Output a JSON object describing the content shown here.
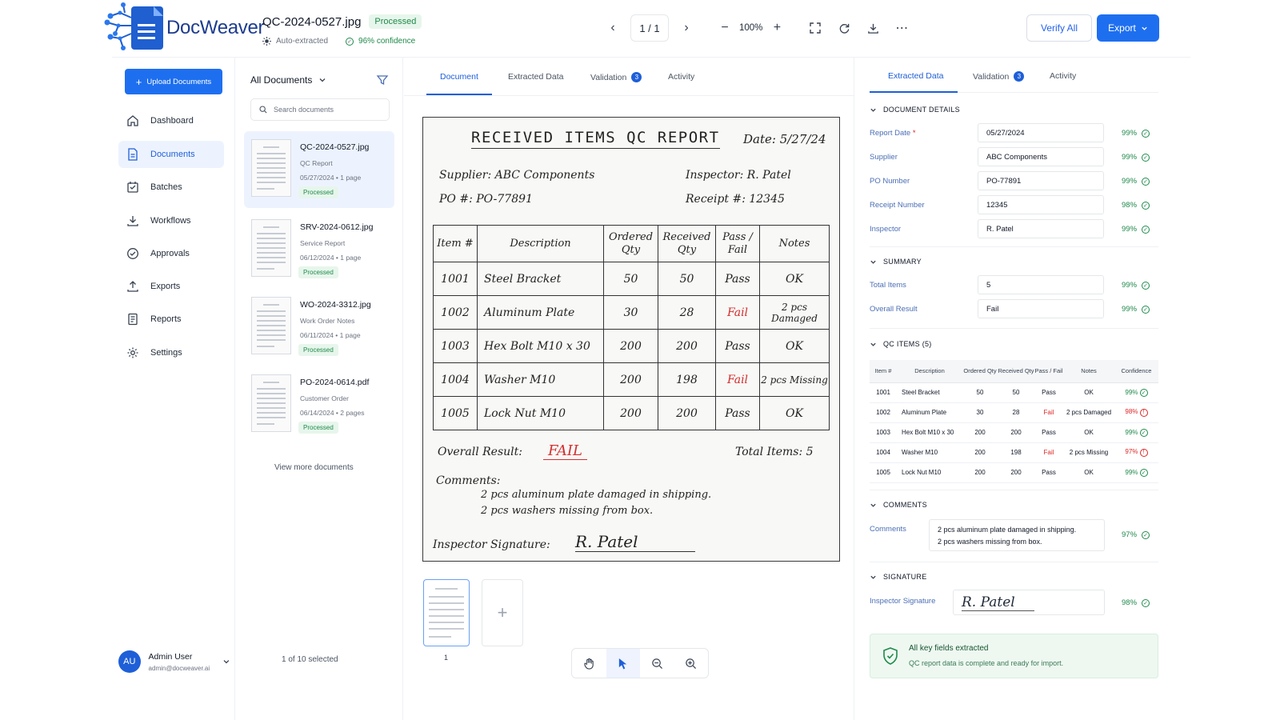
{
  "app": {
    "name": "DocWeaver"
  },
  "document": {
    "filename": "QC-2024-0527.jpg",
    "status": "Processed",
    "extraction": "Auto-extracted",
    "confidence": "96% confidence"
  },
  "viewer_controls": {
    "page": "1 / 1",
    "zoom": "100%"
  },
  "actions": {
    "verify_all": "Verify All",
    "export": "Export"
  },
  "nav": {
    "upload": "Upload Documents",
    "items": [
      {
        "label": "Dashboard",
        "icon": "home-icon"
      },
      {
        "label": "Documents",
        "icon": "document-icon"
      },
      {
        "label": "Batches",
        "icon": "batch-icon"
      },
      {
        "label": "Workflows",
        "icon": "workflow-icon"
      },
      {
        "label": "Approvals",
        "icon": "check-circle-icon"
      },
      {
        "label": "Exports",
        "icon": "export-icon"
      },
      {
        "label": "Reports",
        "icon": "report-icon"
      },
      {
        "label": "Settings",
        "icon": "gear-icon"
      }
    ],
    "active": "Documents"
  },
  "user": {
    "initials": "AU",
    "name": "Admin User",
    "email": "admin@docweaver.ai"
  },
  "doclist": {
    "header": "All Documents",
    "search_placeholder": "Search documents",
    "items": [
      {
        "name": "QC-2024-0527.jpg",
        "type": "QC Report",
        "meta": "05/27/2024 • 1 page",
        "status": "Processed"
      },
      {
        "name": "SRV-2024-0612.jpg",
        "type": "Service Report",
        "meta": "06/12/2024 • 1 page",
        "status": "Processed"
      },
      {
        "name": "WO-2024-3312.jpg",
        "type": "Work Order Notes",
        "meta": "06/11/2024 • 1 page",
        "status": "Processed"
      },
      {
        "name": "PO-2024-0614.pdf",
        "type": "Customer Order",
        "meta": "06/14/2024 • 2 pages",
        "status": "Processed"
      }
    ],
    "view_more": "View more documents",
    "selection": "1 of 10 selected"
  },
  "viewer_tabs": {
    "document": "Document",
    "extracted": "Extracted Data",
    "validation": "Validation",
    "validation_count": "3",
    "activity": "Activity"
  },
  "paper": {
    "title": "RECEIVED ITEMS QC REPORT",
    "date": "Date: 5/27/24",
    "supplier": "Supplier: ABC Components",
    "inspector": "Inspector: R. Patel",
    "po": "PO #: PO-77891",
    "receipt": "Receipt #: 12345",
    "headers": [
      "Item #",
      "Description",
      "Ordered Qty",
      "Received Qty",
      "Pass / Fail",
      "Notes"
    ],
    "rows": [
      [
        "1001",
        "Steel Bracket",
        "50",
        "50",
        "Pass",
        "OK"
      ],
      [
        "1002",
        "Aluminum Plate",
        "30",
        "28",
        "Fail",
        "2 pcs Damaged"
      ],
      [
        "1003",
        "Hex Bolt M10 x 30",
        "200",
        "200",
        "Pass",
        "OK"
      ],
      [
        "1004",
        "Washer M10",
        "200",
        "198",
        "Fail",
        "2 pcs Missing"
      ],
      [
        "1005",
        "Lock Nut M10",
        "200",
        "200",
        "Pass",
        "OK"
      ]
    ],
    "overall_label": "Overall Result:",
    "overall_value": "FAIL",
    "total": "Total Items: 5",
    "comments_label": "Comments:",
    "comment1": "2 pcs aluminum plate damaged in shipping.",
    "comment2": "2 pcs washers missing from box.",
    "signature_label": "Inspector Signature:",
    "signature": "R. Patel"
  },
  "page_thumb_label": "1",
  "panel": {
    "tabs": {
      "extracted": "Extracted Data",
      "validation": "Validation",
      "validation_count": "3",
      "activity": "Activity"
    },
    "doc_details": {
      "title": "DOCUMENT DETAILS",
      "fields": [
        {
          "label": "Report Date",
          "required": "*",
          "value": "05/27/2024",
          "conf": "99%"
        },
        {
          "label": "Supplier",
          "value": "ABC Components",
          "conf": "99%"
        },
        {
          "label": "PO Number",
          "value": "PO-77891",
          "conf": "99%"
        },
        {
          "label": "Receipt Number",
          "value": "12345",
          "conf": "98%"
        },
        {
          "label": "Inspector",
          "value": "R. Patel",
          "conf": "99%"
        }
      ]
    },
    "summary": {
      "title": "SUMMARY",
      "fields": [
        {
          "label": "Total Items",
          "value": "5",
          "conf": "99%"
        },
        {
          "label": "Overall Result",
          "value": "Fail",
          "conf": "99%"
        }
      ]
    },
    "qc_items": {
      "title": "QC ITEMS (5)",
      "headers": [
        "Item #",
        "Description",
        "Ordered Qty",
        "Received Qty",
        "Pass / Fail",
        "Notes",
        "Confidence"
      ],
      "rows": [
        [
          "1001",
          "Steel Bracket",
          "50",
          "50",
          "Pass",
          "OK",
          "99%"
        ],
        [
          "1002",
          "Aluminum Plate",
          "30",
          "28",
          "Fail",
          "2 pcs Damaged",
          "98%"
        ],
        [
          "1003",
          "Hex Bolt M10 x 30",
          "200",
          "200",
          "Pass",
          "OK",
          "99%"
        ],
        [
          "1004",
          "Washer M10",
          "200",
          "198",
          "Fail",
          "2 pcs Missing",
          "97%"
        ],
        [
          "1005",
          "Lock Nut M10",
          "200",
          "200",
          "Pass",
          "OK",
          "99%"
        ]
      ]
    },
    "comments": {
      "title": "COMMENTS",
      "label": "Comments",
      "line1": "2 pcs aluminum plate damaged in shipping.",
      "line2": "2 pcs washers missing from box.",
      "conf": "97%"
    },
    "signature": {
      "title": "SIGNATURE",
      "label": "Inspector Signature",
      "value": "R. Patel",
      "conf": "98%"
    },
    "alert": {
      "title": "All key fields extracted",
      "subtitle": "QC report data is complete and ready for import."
    }
  },
  "colors": {
    "accent": "#1e6ff0",
    "success": "#1e8a4a",
    "danger": "#dc2626"
  }
}
